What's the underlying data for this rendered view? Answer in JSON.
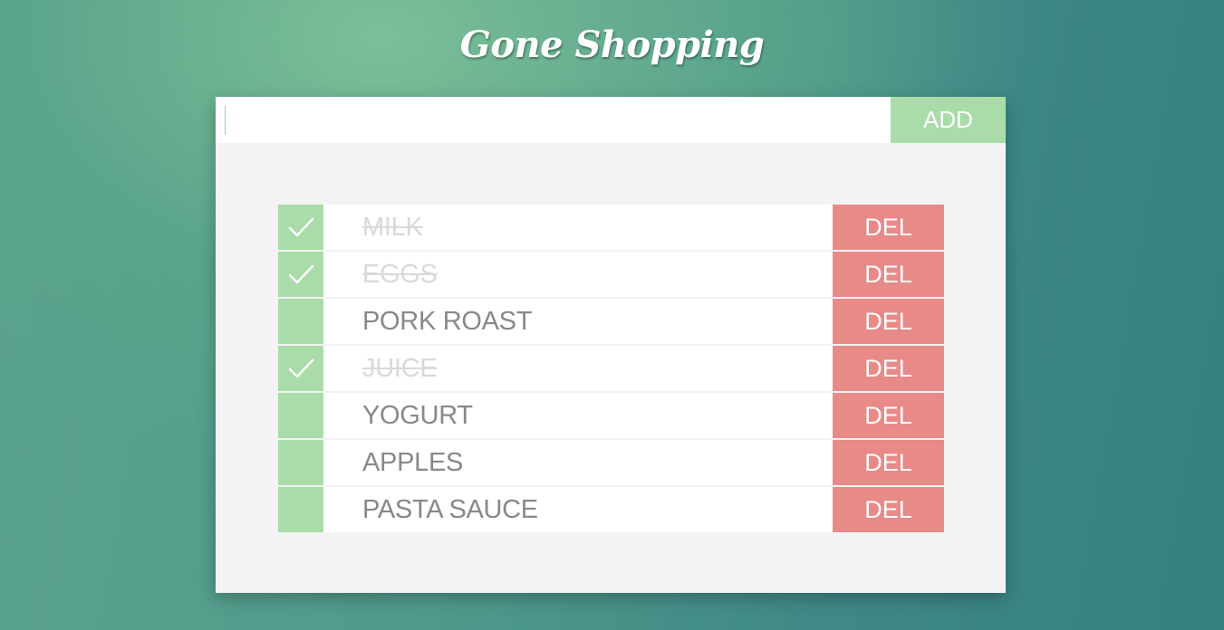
{
  "app": {
    "title": "Gone Shopping"
  },
  "add_form": {
    "input_value": "",
    "input_placeholder": "",
    "add_label": "ADD"
  },
  "items": [
    {
      "label": "MILK",
      "done": true,
      "delete_label": "DEL"
    },
    {
      "label": "EGGS",
      "done": true,
      "delete_label": "DEL"
    },
    {
      "label": "PORK ROAST",
      "done": false,
      "delete_label": "DEL"
    },
    {
      "label": "JUICE",
      "done": true,
      "delete_label": "DEL"
    },
    {
      "label": "YOGURT",
      "done": false,
      "delete_label": "DEL"
    },
    {
      "label": "APPLES",
      "done": false,
      "delete_label": "DEL"
    },
    {
      "label": "PASTA SAUCE",
      "done": false,
      "delete_label": "DEL"
    }
  ],
  "icons": {
    "check": "checkmark-icon"
  },
  "colors": {
    "accent_green": "#a9dca8",
    "delete_red": "#e88a88",
    "done_text": "#d9d9d9",
    "item_text": "#888888",
    "panel_bg": "#f3f3f3"
  }
}
